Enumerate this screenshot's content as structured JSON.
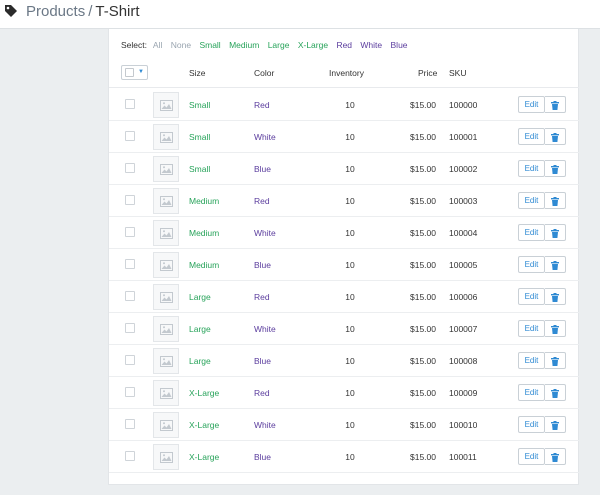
{
  "header": {
    "breadcrumb": "Products",
    "separator": "/",
    "current": "T-Shirt",
    "icon": "tag-icon"
  },
  "select": {
    "label": "Select:",
    "options": [
      {
        "label": "All",
        "color": "#9aa5b0"
      },
      {
        "label": "None",
        "color": "#9aa5b0"
      },
      {
        "label": "Small",
        "color": "#27a35a"
      },
      {
        "label": "Medium",
        "color": "#27a35a"
      },
      {
        "label": "Large",
        "color": "#27a35a"
      },
      {
        "label": "X-Large",
        "color": "#27a35a"
      },
      {
        "label": "Red",
        "color": "#5b3d9e"
      },
      {
        "label": "White",
        "color": "#5b3d9e"
      },
      {
        "label": "Blue",
        "color": "#5b3d9e"
      }
    ]
  },
  "table": {
    "columns": {
      "size": "Size",
      "color": "Color",
      "inventory": "Inventory",
      "price": "Price",
      "sku": "SKU"
    },
    "edit_label": "Edit",
    "rows": [
      {
        "size": "Small",
        "color": "Red",
        "inventory": "10",
        "price": "$15.00",
        "sku": "100000"
      },
      {
        "size": "Small",
        "color": "White",
        "inventory": "10",
        "price": "$15.00",
        "sku": "100001"
      },
      {
        "size": "Small",
        "color": "Blue",
        "inventory": "10",
        "price": "$15.00",
        "sku": "100002"
      },
      {
        "size": "Medium",
        "color": "Red",
        "inventory": "10",
        "price": "$15.00",
        "sku": "100003"
      },
      {
        "size": "Medium",
        "color": "White",
        "inventory": "10",
        "price": "$15.00",
        "sku": "100004"
      },
      {
        "size": "Medium",
        "color": "Blue",
        "inventory": "10",
        "price": "$15.00",
        "sku": "100005"
      },
      {
        "size": "Large",
        "color": "Red",
        "inventory": "10",
        "price": "$15.00",
        "sku": "100006"
      },
      {
        "size": "Large",
        "color": "White",
        "inventory": "10",
        "price": "$15.00",
        "sku": "100007"
      },
      {
        "size": "Large",
        "color": "Blue",
        "inventory": "10",
        "price": "$15.00",
        "sku": "100008"
      },
      {
        "size": "X-Large",
        "color": "Red",
        "inventory": "10",
        "price": "$15.00",
        "sku": "100009"
      },
      {
        "size": "X-Large",
        "color": "White",
        "inventory": "10",
        "price": "$15.00",
        "sku": "100010"
      },
      {
        "size": "X-Large",
        "color": "Blue",
        "inventory": "10",
        "price": "$15.00",
        "sku": "100011"
      }
    ]
  },
  "colors": {
    "size_text": "#27a35a",
    "color_text": "#5b3d9e",
    "accent": "#2f8ad3"
  }
}
